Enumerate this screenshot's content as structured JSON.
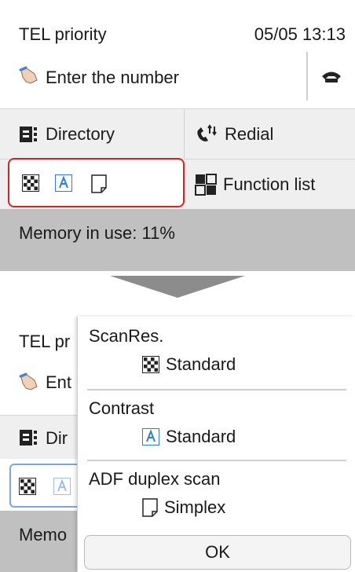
{
  "top": {
    "status": {
      "mode": "TEL priority",
      "datetime": "05/05 13:13"
    },
    "number": {
      "label": "Enter the number",
      "hand_icon": "pointing-hand-icon",
      "hook_icon": "phone-hook-icon"
    },
    "buttons": {
      "directory": {
        "label": "Directory",
        "icon": "directory-book-icon"
      },
      "redial": {
        "label": "Redial",
        "icon": "redial-phone-icon"
      },
      "function_list": {
        "label": "Function list",
        "icon": "function-list-icon"
      },
      "settings_icons": [
        "scan-resolution-icon",
        "contrast-icon",
        "simplex-page-icon"
      ]
    },
    "memory": {
      "label": "Memory in use: 11%"
    }
  },
  "bottom": {
    "background": {
      "mode": "TEL pr",
      "number": "Ent",
      "directory": "Dir",
      "memory": "Memo"
    },
    "popup": {
      "items": [
        {
          "title": "ScanRes.",
          "value": "Standard",
          "icon": "scan-resolution-icon"
        },
        {
          "title": "Contrast",
          "value": "Standard",
          "icon": "contrast-icon"
        },
        {
          "title": "ADF duplex scan",
          "value": "Simplex",
          "icon": "simplex-page-icon"
        }
      ],
      "ok_label": "OK"
    }
  },
  "colors": {
    "highlight": "#e02020",
    "memory_bar": "#c0c0c0",
    "button_row": "#efefef",
    "arrow": "#8c8c8c",
    "icon_blue": "#2f7fd6"
  }
}
